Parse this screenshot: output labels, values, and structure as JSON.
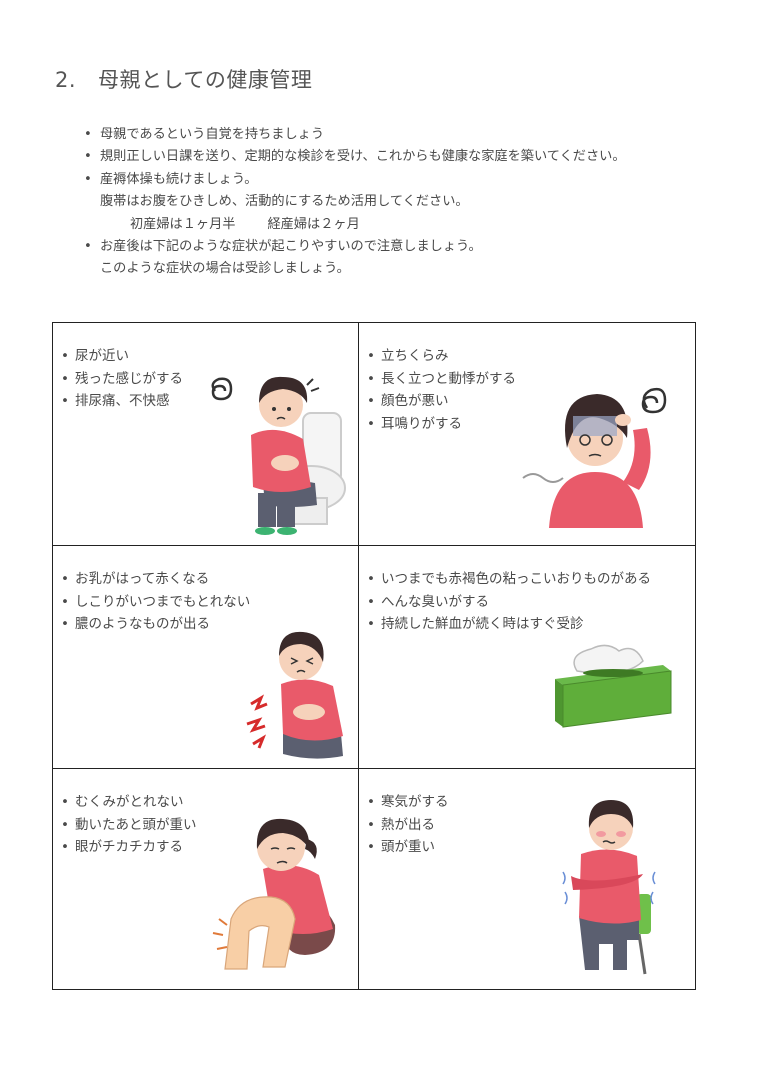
{
  "title": {
    "number": "2.",
    "text": "母親としての健康管理"
  },
  "intro": {
    "bullet": "•",
    "line1": "母親であるという自覚を持ちましょう",
    "line2": "規則正しい日課を送り、定期的な検診を受け、これからも健康な家庭を築いてください。",
    "line3": "産褥体操も続けましょう。",
    "line3_sub": "腹帯はお腹をひきしめ、活動的にするため活用してください。",
    "line3_sub2a": "初産婦は１ヶ月半",
    "line3_sub2b": "経産婦は２ヶ月",
    "line4": "お産後は下記のような症状が起こりやすいので注意しましょう。",
    "line4_sub": "このような症状の場合は受診しましょう。"
  },
  "symptoms": {
    "bullet": "•",
    "cell1": [
      "尿が近い",
      "残った感じがする",
      "排尿痛、不快感"
    ],
    "cell2": [
      "立ちくらみ",
      "長く立つと動悸がする",
      "顔色が悪い",
      "耳鳴りがする"
    ],
    "cell3": [
      "お乳がはって赤くなる",
      "しこりがいつまでもとれない",
      "膿のようなものが出る"
    ],
    "cell4": [
      "いつまでも赤褐色の粘っこいおりものがある",
      "へんな臭いがする",
      "持続した鮮血が続く時はすぐ受診"
    ],
    "cell5": [
      "むくみがとれない",
      "動いたあと頭が重い",
      "眼がチカチカする"
    ],
    "cell6": [
      "寒気がする",
      "熱が出る",
      "頭が重い"
    ]
  },
  "colors": {
    "shirt": "#e95a6a",
    "hair": "#3a2a2a",
    "pants": "#5b5f70",
    "skin": "#f6d2bb",
    "tissue_box": "#5fae3a"
  }
}
